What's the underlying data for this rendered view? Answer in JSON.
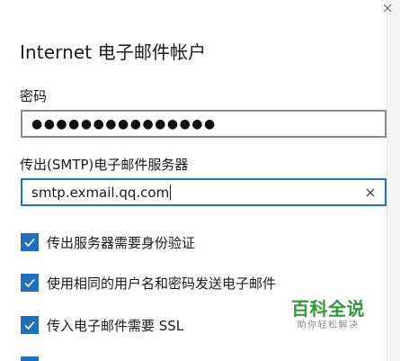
{
  "dialog": {
    "title": "Internet 电子邮件帐户",
    "close_icon": "close-icon"
  },
  "password": {
    "label": "密码",
    "masked_value": "●●●●●●●●●●●●●●●"
  },
  "smtp_server": {
    "label": "传出(SMTP)电子邮件服务器",
    "value": "smtp.exmail.qq.com",
    "clear_icon": "clear-icon"
  },
  "options": [
    {
      "label": "传出服务器需要身份验证",
      "checked": true
    },
    {
      "label": "使用相同的用户名和密码发送电子邮件",
      "checked": true
    },
    {
      "label": "传入电子邮件需要 SSL",
      "checked": true
    }
  ],
  "watermark": {
    "title": "百科全说",
    "subtitle": "助你轻松解决"
  },
  "colors": {
    "accent": "#1e6fc4",
    "focus_border": "#1e73c8",
    "input_border": "#8a8a8a",
    "watermark_green": "#2f9a3a"
  }
}
